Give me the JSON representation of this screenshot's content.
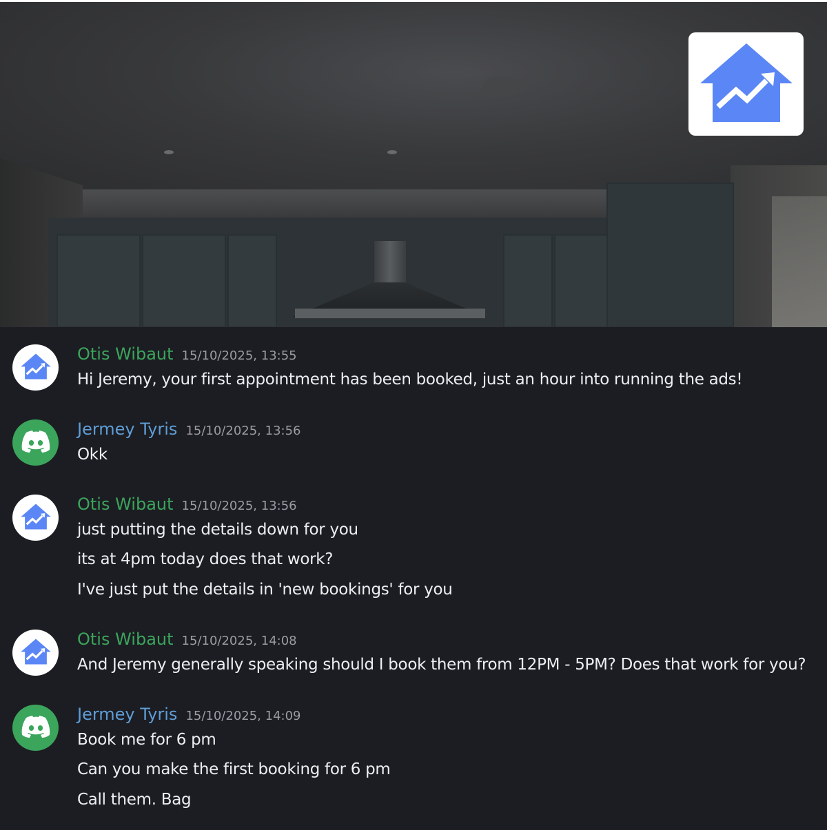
{
  "banner": {
    "logo_icon": "house-chart-icon",
    "brand_color": "#5b86f5"
  },
  "messages": [
    {
      "author": "Otis Wibaut",
      "author_color": "#3ba55c",
      "timestamp": "15/10/2025, 13:55",
      "avatar_icon": "house-chart-icon",
      "lines": [
        "Hi Jeremy, your first appointment has been booked, just an hour into running the ads!"
      ]
    },
    {
      "author": "Jermey Tyris",
      "author_color": "#5e9dd6",
      "timestamp": "15/10/2025, 13:56",
      "avatar_icon": "discord-icon",
      "lines": [
        "Okk"
      ]
    },
    {
      "author": "Otis Wibaut",
      "author_color": "#3ba55c",
      "timestamp": "15/10/2025, 13:56",
      "avatar_icon": "house-chart-icon",
      "lines": [
        "just putting the details down for you",
        "its at 4pm today does that work?",
        "I've just put the details in 'new bookings' for you"
      ]
    },
    {
      "author": "Otis Wibaut",
      "author_color": "#3ba55c",
      "timestamp": "15/10/2025, 14:08",
      "avatar_icon": "house-chart-icon",
      "lines": [
        "And Jeremy generally speaking should I book them from 12PM - 5PM? Does that work for you?"
      ]
    },
    {
      "author": "Jermey Tyris",
      "author_color": "#5e9dd6",
      "timestamp": "15/10/2025, 14:09",
      "avatar_icon": "discord-icon",
      "lines": [
        "Book me for 6 pm",
        "Can you make the first booking for 6 pm",
        "Call them. Bag"
      ]
    }
  ]
}
